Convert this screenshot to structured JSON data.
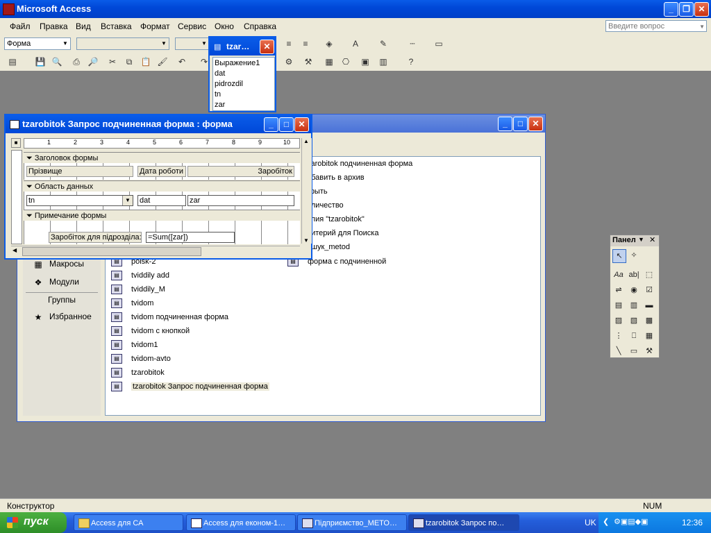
{
  "app": {
    "title": "Microsoft Access"
  },
  "menu": [
    "Файл",
    "Правка",
    "Вид",
    "Вставка",
    "Формат",
    "Сервис",
    "Окно",
    "Справка"
  ],
  "ask_placeholder": "Введите вопрос",
  "toolbar": {
    "object_combo": "Форма"
  },
  "field_list": {
    "title": "tzar…",
    "fields": [
      "Выражение1",
      "dat",
      "pidrozdil",
      "tn",
      "zar"
    ]
  },
  "form_window": {
    "title": "tzarobitok Запрос подчиненная форма : форма",
    "ruler": [
      "1",
      "2",
      "3",
      "4",
      "5",
      "6",
      "7",
      "8",
      "9",
      "10"
    ],
    "sections": {
      "header": "Заголовок формы",
      "detail": "Область данных",
      "footer": "Примечание формы"
    },
    "header_labels": [
      "Прізвище",
      "Дата роботи",
      "Заробіток"
    ],
    "detail_fields": [
      "tn",
      "dat",
      "zar"
    ],
    "footer_label": "Заробіток для підрозділа:",
    "footer_value": "=Sum([zar])"
  },
  "db_window": {
    "side_items": [
      "Макросы",
      "Модули"
    ],
    "groups_label": "Группы",
    "favorites": "Избранное",
    "col1": [
      "poisk-2",
      "tviddily add",
      "tviddily_M",
      "tvidom",
      "tvidom подчиненная форма",
      "tvidom с кнопкой",
      "tvidom1",
      "tvidom-avto",
      "tzarobitok",
      "tzarobitok Запрос подчиненная форма"
    ],
    "col2": [
      "tzarobitok подчиненная форма",
      "Добавить в архив",
      "Закрыть",
      "Количество",
      "Копия \"tzarobitok\"",
      "Критерий для Поиска",
      "Пошук_metod",
      "форма с подчиненной"
    ],
    "col2_visible": [
      "zarobitok подчиненная форма",
      "обавить в архив",
      "крыть",
      "оличество",
      "опия \"tzarobitok\"",
      "ритерий для Поиска",
      "ошук_metod",
      "форма с подчиненной"
    ]
  },
  "toolbox": {
    "title": "Панел"
  },
  "status": {
    "left": "Конструктор",
    "num": "NUM"
  },
  "taskbar": {
    "start": "пуск",
    "tasks": [
      "Access для СА",
      "Access для економ-1…",
      "Підприємство_МЕТО…",
      "tzarobitok Запрос по…"
    ],
    "lang": "UK",
    "clock": "12:36"
  }
}
